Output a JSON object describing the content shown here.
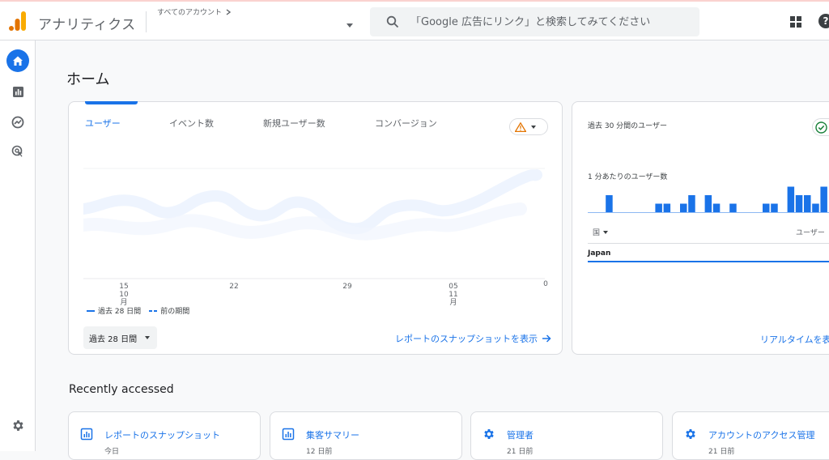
{
  "header": {
    "app_title": "アナリティクス",
    "account_label": "すべてのアカウント",
    "search_placeholder": "「Google 広告にリンク」と検索してみてください"
  },
  "colors": {
    "accent": "#1a73e8",
    "logo_orange": "#f9ab00",
    "logo_dark_orange": "#e37400",
    "warning": "#e37400",
    "ok": "#188038"
  },
  "sidebar": {
    "items": [
      {
        "icon": "home-icon",
        "active": true
      },
      {
        "icon": "reports-icon",
        "active": false
      },
      {
        "icon": "explore-icon",
        "active": false
      },
      {
        "icon": "advertising-icon",
        "active": false
      }
    ],
    "bottom_icon": "settings-icon"
  },
  "page": {
    "title": "ホーム"
  },
  "overview_card": {
    "tabs": [
      {
        "label": "ユーザー",
        "active": true
      },
      {
        "label": "イベント数",
        "active": false
      },
      {
        "label": "新規ユーザー数",
        "active": false
      },
      {
        "label": "コンバージョン",
        "active": false
      }
    ],
    "x_ticks": [
      {
        "day": "15",
        "month": "10月"
      },
      {
        "day": "22",
        "month": ""
      },
      {
        "day": "29",
        "month": ""
      },
      {
        "day": "05",
        "month": "11月"
      }
    ],
    "y_zero": "0",
    "legend": {
      "current": "過去 28 日間",
      "previous": "前の期間"
    },
    "range_button": "過去 28 日間",
    "snapshot_link": "レポートのスナップショットを表示"
  },
  "realtime_card": {
    "title": "過去 30 分間のユーザー",
    "subtitle": "1 分あたりのユーザー数",
    "column_country": "国",
    "column_users": "ユーザー",
    "country_row": "Japan",
    "link": "リアルタイムを表示",
    "bars_per_minute": [
      0,
      2,
      0,
      0,
      0,
      0,
      0,
      1,
      1,
      0,
      1,
      2,
      0,
      2,
      1,
      0,
      1,
      0,
      0,
      0,
      1,
      1,
      0,
      3,
      2,
      2,
      1,
      3
    ]
  },
  "recently_accessed": {
    "title": "Recently accessed",
    "items": [
      {
        "icon": "report-icon",
        "label": "レポートのスナップショット",
        "meta": "今日"
      },
      {
        "icon": "report-icon",
        "label": "集客サマリー",
        "meta": "12 日前"
      },
      {
        "icon": "gear-icon",
        "label": "管理者",
        "meta": "21 日前"
      },
      {
        "icon": "gear-icon",
        "label": "アカウントのアクセス管理",
        "meta": "21 日前"
      }
    ]
  }
}
